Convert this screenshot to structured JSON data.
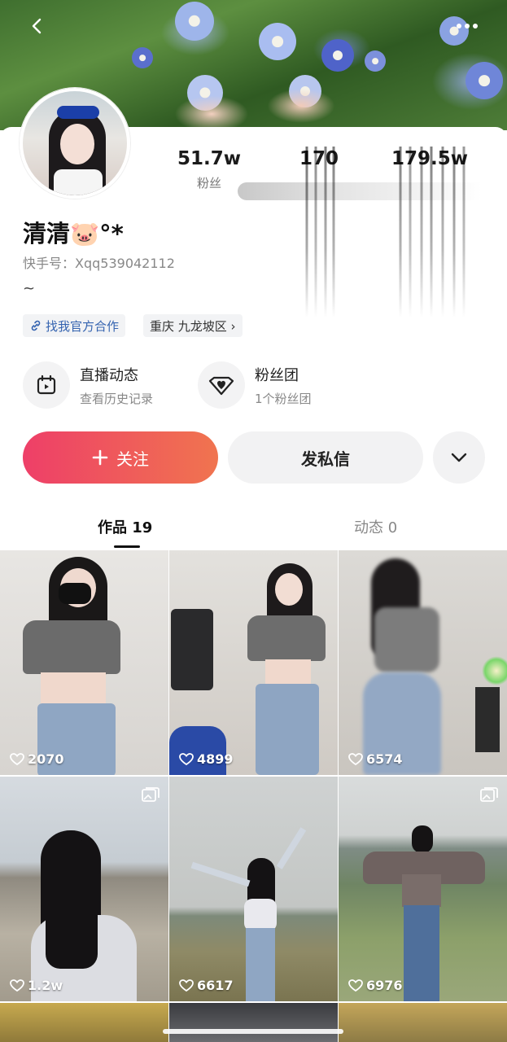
{
  "header": {
    "back_icon": "chevron-left-icon",
    "more_icon": "ellipsis-icon"
  },
  "profile": {
    "name": "清清🐷°*",
    "kuaishou_id": "快手号：Xqq539042112",
    "bio": "~",
    "stats": [
      {
        "value": "51.7w",
        "label": "粉丝"
      },
      {
        "value": "170",
        "label": ""
      },
      {
        "value": "179.5w",
        "label": ""
      }
    ],
    "tags": [
      {
        "icon": "link-icon",
        "label": "找我官方合作"
      },
      {
        "label": "重庆 九龙坡区 ›"
      }
    ]
  },
  "quick_links": [
    {
      "icon": "calendar-play-icon",
      "title": "直播动态",
      "subtitle": "查看历史记录"
    },
    {
      "icon": "heart-badge-icon",
      "title": "粉丝团",
      "subtitle": "1个粉丝团"
    }
  ],
  "actions": {
    "follow_label": "关注",
    "message_label": "发私信"
  },
  "tabs": [
    {
      "label": "作品 19",
      "active": true
    },
    {
      "label": "动态 0",
      "active": false
    }
  ],
  "posts": [
    {
      "likes": "2070",
      "album": false
    },
    {
      "likes": "4899",
      "album": false
    },
    {
      "likes": "6574",
      "album": false
    },
    {
      "likes": "1.2w",
      "album": true
    },
    {
      "likes": "6617",
      "album": false
    },
    {
      "likes": "6976",
      "album": true
    }
  ],
  "colors": {
    "follow_start": "#ee3f68",
    "follow_end": "#f0744f",
    "link_blue": "#3463b0"
  }
}
